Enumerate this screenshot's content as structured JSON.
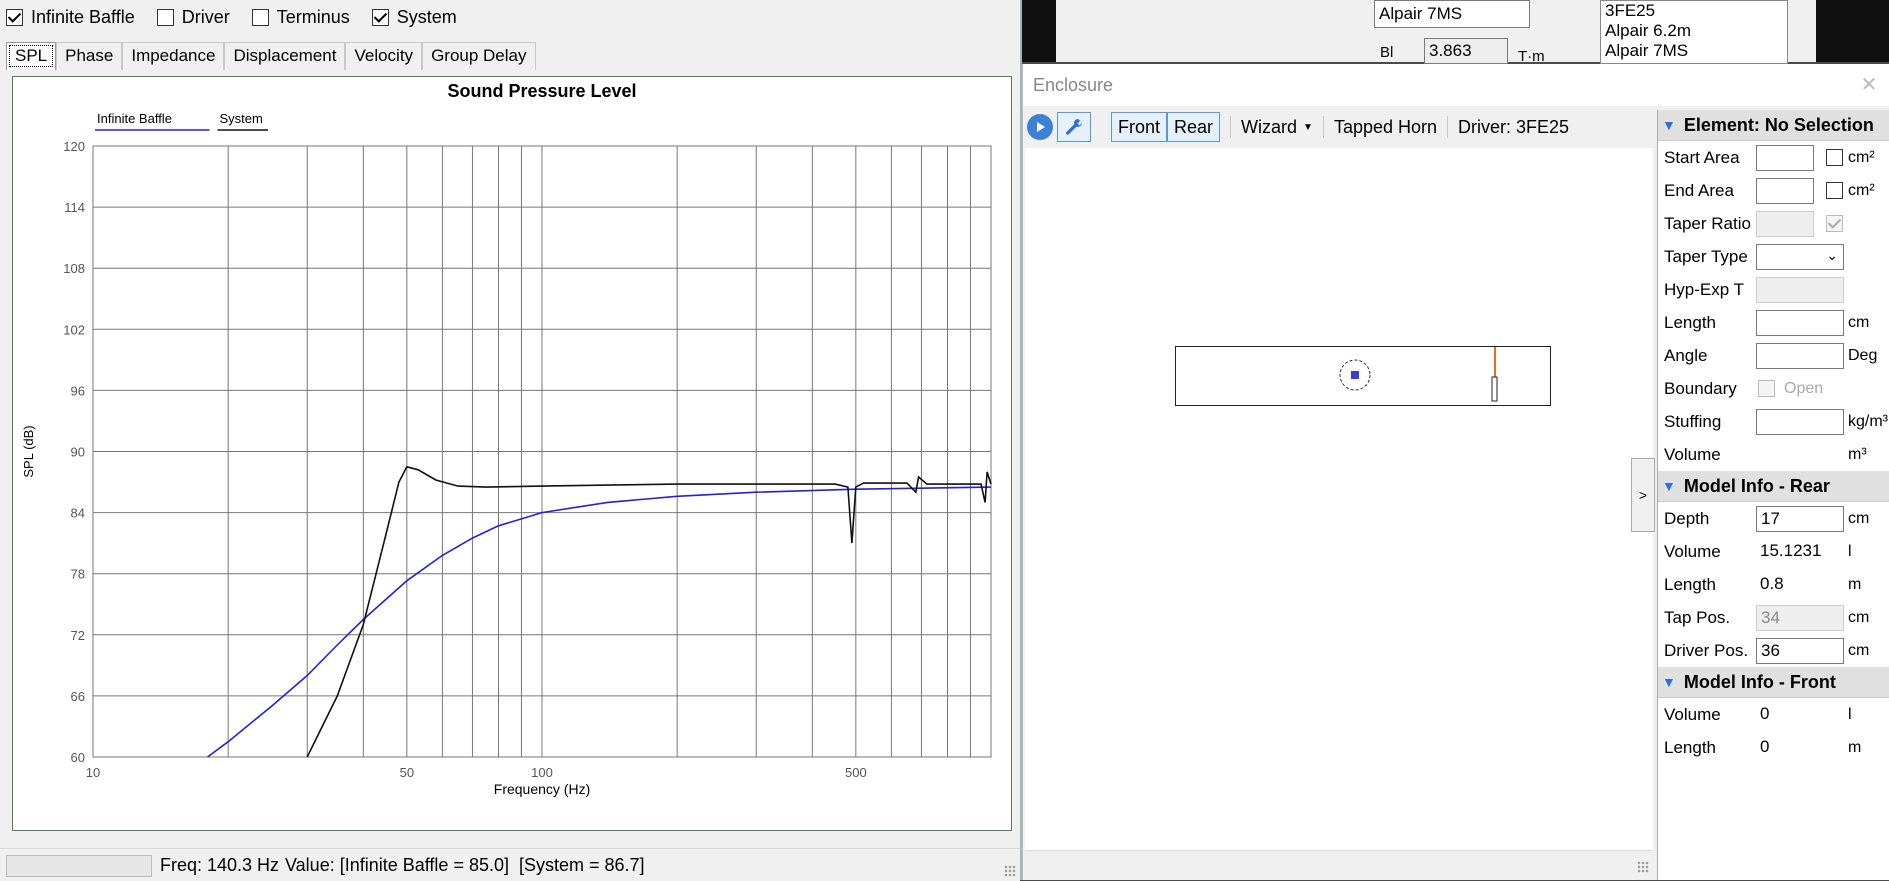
{
  "left": {
    "checkboxes": [
      {
        "label": "Infinite Baffle",
        "checked": true
      },
      {
        "label": "Driver",
        "checked": false
      },
      {
        "label": "Terminus",
        "checked": false
      },
      {
        "label": "System",
        "checked": true
      }
    ],
    "tabs": [
      "SPL",
      "Phase",
      "Impedance",
      "Displacement",
      "Velocity",
      "Group Delay"
    ],
    "status": {
      "freq": "Freq: 140.3 Hz",
      "value": "Value: [Infinite Baffle = 85.0]  [System = 86.7]"
    }
  },
  "chart_data": {
    "type": "line",
    "title": "Sound Pressure Level",
    "xlabel": "Frequency (Hz)",
    "ylabel": "SPL (dB)",
    "xscale": "log",
    "xlim": [
      10,
      1000
    ],
    "ylim": [
      60,
      120
    ],
    "yticks": [
      60,
      66,
      72,
      78,
      84,
      90,
      96,
      102,
      108,
      114,
      120
    ],
    "xtick_labels": [
      {
        "v": 10,
        "t": "10"
      },
      {
        "v": 50,
        "t": "50"
      },
      {
        "v": 100,
        "t": "100"
      },
      {
        "v": 500,
        "t": "500"
      }
    ],
    "legend": [
      "Infinite Baffle",
      "System"
    ],
    "legend_position": "top-left",
    "series": [
      {
        "name": "Infinite Baffle",
        "color": "#2222dd",
        "points": [
          [
            18,
            60
          ],
          [
            20,
            61.5
          ],
          [
            25,
            65
          ],
          [
            30,
            68
          ],
          [
            35,
            71
          ],
          [
            40,
            73.5
          ],
          [
            50,
            77.3
          ],
          [
            60,
            79.8
          ],
          [
            70,
            81.5
          ],
          [
            80,
            82.7
          ],
          [
            100,
            84
          ],
          [
            140,
            85
          ],
          [
            200,
            85.6
          ],
          [
            300,
            86
          ],
          [
            500,
            86.3
          ],
          [
            700,
            86.4
          ],
          [
            1000,
            86.5
          ]
        ]
      },
      {
        "name": "System",
        "color": "#111111",
        "points": [
          [
            30,
            60
          ],
          [
            35,
            66
          ],
          [
            40,
            73
          ],
          [
            45,
            82
          ],
          [
            48,
            87
          ],
          [
            50,
            88.5
          ],
          [
            53,
            88.2
          ],
          [
            58,
            87.2
          ],
          [
            65,
            86.6
          ],
          [
            75,
            86.5
          ],
          [
            100,
            86.6
          ],
          [
            140,
            86.7
          ],
          [
            200,
            86.8
          ],
          [
            300,
            86.8
          ],
          [
            450,
            86.8
          ],
          [
            480,
            86.5
          ],
          [
            490,
            81
          ],
          [
            500,
            86.5
          ],
          [
            520,
            86.9
          ],
          [
            650,
            86.9
          ],
          [
            680,
            86
          ],
          [
            690,
            87.5
          ],
          [
            720,
            86.8
          ],
          [
            950,
            86.8
          ],
          [
            970,
            85
          ],
          [
            980,
            88
          ],
          [
            1000,
            86.8
          ]
        ]
      }
    ]
  },
  "enclosure": {
    "title": "Enclosure",
    "toolbar": {
      "front": "Front",
      "rear": "Rear",
      "wizard": "Wizard",
      "tapped_horn": "Tapped Horn",
      "driver": "Driver: 3FE25"
    },
    "element_header": "Element: No Selection",
    "element_rows": [
      {
        "label": "Start Area",
        "unit": "cm²"
      },
      {
        "label": "End Area",
        "unit": "cm²"
      },
      {
        "label": "Taper Ratio",
        "unit": ""
      },
      {
        "label": "Taper Type",
        "unit": ""
      },
      {
        "label": "Hyp-Exp T",
        "unit": ""
      },
      {
        "label": "Length",
        "unit": "cm"
      },
      {
        "label": "Angle",
        "unit": "Deg"
      },
      {
        "label": "Boundary",
        "unit": "Open"
      },
      {
        "label": "Stuffing",
        "unit": "kg/m³"
      },
      {
        "label": "Volume",
        "unit": "m³"
      }
    ],
    "rear_header": "Model Info - Rear",
    "rear_rows": [
      {
        "label": "Depth",
        "value": "17",
        "unit": "cm"
      },
      {
        "label": "Volume",
        "value": "15.1231",
        "unit": "l"
      },
      {
        "label": "Length",
        "value": "0.8",
        "unit": "m"
      },
      {
        "label": "Tap Pos.",
        "value": "34",
        "unit": "cm"
      },
      {
        "label": "Driver Pos.",
        "value": "36",
        "unit": "cm"
      }
    ],
    "front_header": "Model Info - Front",
    "front_rows": [
      {
        "label": "Volume",
        "value": "0",
        "unit": "l"
      },
      {
        "label": "Length",
        "value": "0",
        "unit": "m"
      }
    ]
  },
  "background_window": {
    "name_field": "Alpair 7MS",
    "bl_label": "Bl",
    "bl_value": "3.863",
    "bl_unit": "T·m",
    "list": [
      "3FE25",
      "Alpair 6.2m",
      "Alpair 7MS"
    ]
  }
}
